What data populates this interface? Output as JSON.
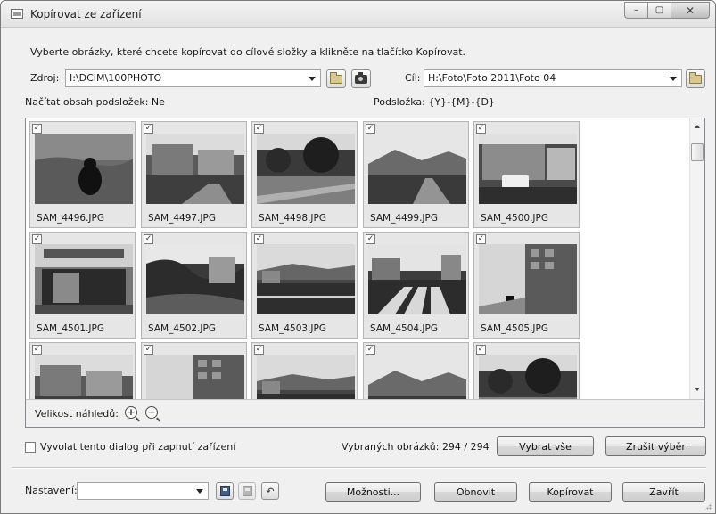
{
  "window": {
    "title": "Kopírovat ze zařízení",
    "minimize": "–",
    "maximize": "▢",
    "close": "✕"
  },
  "instruction": "Vyberte obrázky, které chcete kopírovat do cílové složky a klikněte na tlačítko Kopírovat.",
  "source": {
    "label": "Zdroj:",
    "value": "I:\\DCIM\\100PHOTO"
  },
  "target": {
    "label": "Cíl:",
    "value": "H:\\Foto\\Foto 2011\\Foto 04"
  },
  "subfolders_info": "Načítat obsah podsložek: Ne",
  "subfolder_pattern": "Podsložka: {Y}-{M}-{D}",
  "check_mark": "✓",
  "thumbnails": [
    {
      "name": "SAM_4496.JPG",
      "scene": "cat"
    },
    {
      "name": "SAM_4497.JPG",
      "scene": "street"
    },
    {
      "name": "SAM_4498.JPG",
      "scene": "trees"
    },
    {
      "name": "SAM_4499.JPG",
      "scene": "hills"
    },
    {
      "name": "SAM_4500.JPG",
      "scene": "shops"
    },
    {
      "name": "SAM_4501.JPG",
      "scene": "store"
    },
    {
      "name": "SAM_4502.JPG",
      "scene": "valley"
    },
    {
      "name": "SAM_4503.JPG",
      "scene": "road"
    },
    {
      "name": "SAM_4504.JPG",
      "scene": "crossing"
    },
    {
      "name": "SAM_4505.JPG",
      "scene": "building"
    },
    {
      "name": "",
      "scene": "street"
    },
    {
      "name": "",
      "scene": "building"
    },
    {
      "name": "",
      "scene": "road"
    },
    {
      "name": "",
      "scene": "hills"
    },
    {
      "name": "",
      "scene": "trees"
    }
  ],
  "zoom": {
    "label": "Velikost náhledů:",
    "plus": "+",
    "minus": "−"
  },
  "auto_dialog": {
    "label": "Vyvolat tento dialog při zapnutí zařízení",
    "checked": false
  },
  "selected_count": "Vybraných obrázků: 294 / 294",
  "buttons": {
    "select_all": "Vybrat vše",
    "deselect": "Zrušit výběr",
    "options": "Možnosti...",
    "refresh": "Obnovit",
    "copy": "Kopírovat",
    "close": "Zavřít",
    "undo": "↶"
  },
  "settings": {
    "label": "Nastavení:",
    "value": ""
  }
}
